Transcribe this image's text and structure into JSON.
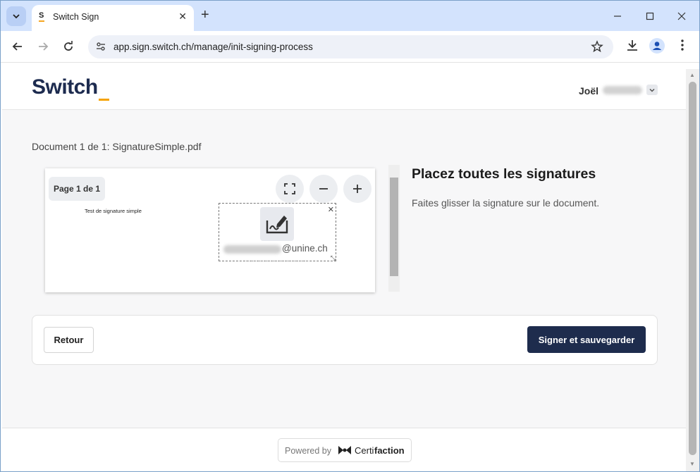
{
  "browser": {
    "tab_title": "Switch Sign",
    "tab_favicon": "S",
    "url": "app.sign.switch.ch/manage/init-signing-process"
  },
  "header": {
    "logo": "Switch",
    "user_first_name": "Joël"
  },
  "document": {
    "title": "Document 1 de 1: SignatureSimple.pdf",
    "page_badge": "Page 1 de 1",
    "pdf_text": "Test de signature simple",
    "signature_email_domain": "@unine.ch"
  },
  "side_panel": {
    "title": "Placez toutes les signatures",
    "instruction": "Faites glisser la signature sur le document."
  },
  "actions": {
    "back_label": "Retour",
    "sign_label": "Signer et sauvegarder"
  },
  "footer": {
    "powered_by": "Powered by",
    "brand_part1": "Certi",
    "brand_part2": "faction"
  },
  "colors": {
    "brand_navy": "#1e2c4d",
    "brand_accent": "#f5a300",
    "tabbar": "#d3e3fd"
  },
  "icons": {
    "fullscreen": "fullscreen-icon",
    "zoom_out": "minus-icon",
    "zoom_in": "plus-icon",
    "signature": "signature-icon",
    "close": "close-icon",
    "resize": "resize-icon"
  }
}
